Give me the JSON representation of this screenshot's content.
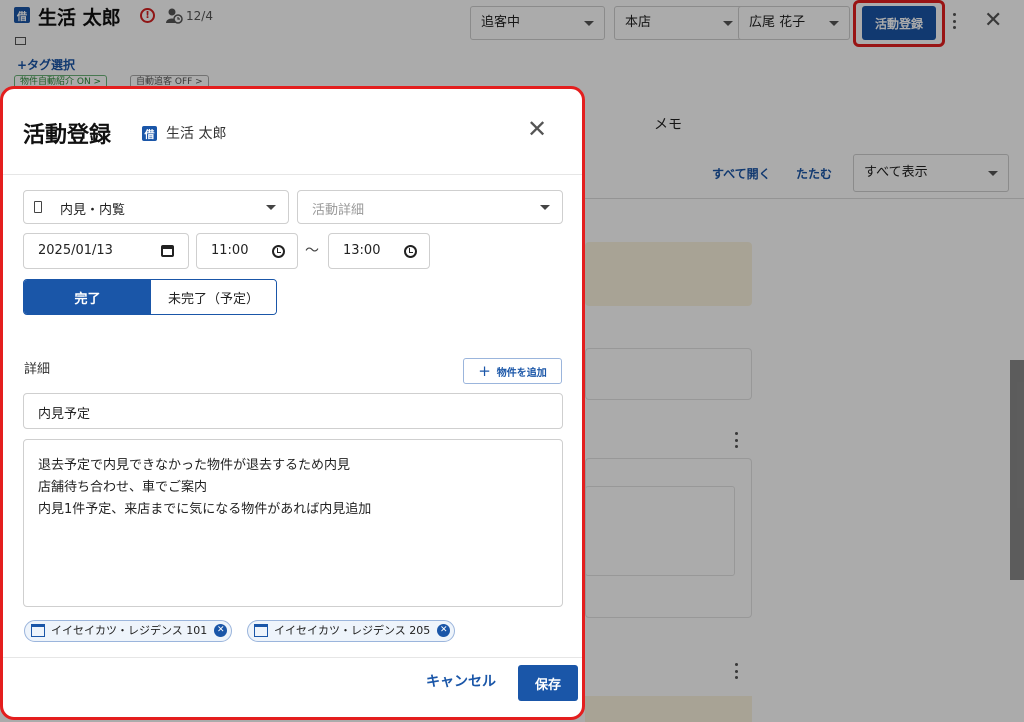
{
  "header": {
    "kind_badge": "借",
    "customer_name": "生活 太郎",
    "alert_mark": "!",
    "visit_count": "12/4",
    "tag_select": "+タグ選択",
    "auto_intro_chip": "物件自動紹介 ON >",
    "auto_follow_chip": "自動追客 OFF >",
    "status_select": "追客中",
    "store_select": "本店",
    "staff_select": "広尾 花子",
    "register_button": "活動登録",
    "close_glyph": "✕"
  },
  "main": {
    "tab_memo": "メモ",
    "expand_all": "すべて開く",
    "collapse_all": "たたむ",
    "filter_select": "すべて表示"
  },
  "modal": {
    "title": "活動登録",
    "kind_badge": "借",
    "customer_name": "生活 太郎",
    "close_glyph": "✕",
    "activity_type": "内見・内覧",
    "activity_detail_placeholder": "活動詳細",
    "date": "2025/01/13",
    "start_time": "11:00",
    "range_separator": "〜",
    "end_time": "13:00",
    "status_done": "完了",
    "status_todo": "未完了（予定）",
    "detail_label": "詳細",
    "add_property_button": "物件を追加",
    "subject": "内見予定",
    "body_lines": [
      "退去予定で内見できなかった物件が退去するため内見",
      "店舗待ち合わせ、車でご案内",
      "内見1件予定、来店までに気になる物件があれば内見追加"
    ],
    "properties": [
      "イイセイカツ・レジデンス 101",
      "イイセイカツ・レジデンス 205"
    ],
    "cancel_button": "キャンセル",
    "save_button": "保存"
  },
  "colors": {
    "primary": "#1a56a8",
    "highlight": "#e41e1e",
    "note_bg": "#fbf3df"
  }
}
